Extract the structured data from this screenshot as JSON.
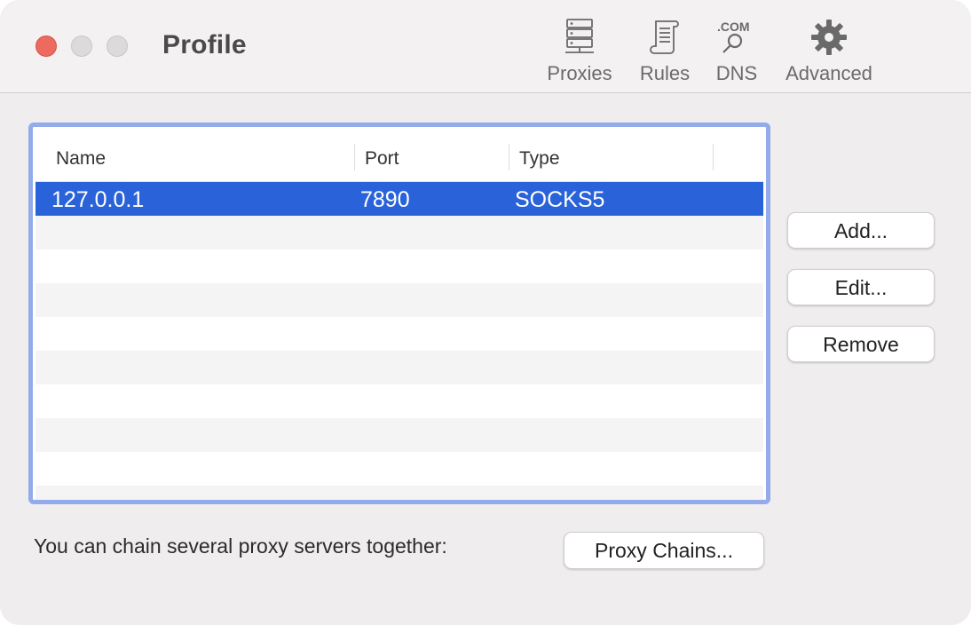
{
  "window": {
    "title": "Profile"
  },
  "toolbar": {
    "items": [
      {
        "label": "Proxies",
        "icon": "server-stack-icon"
      },
      {
        "label": "Rules",
        "icon": "scroll-document-icon"
      },
      {
        "label": "DNS",
        "icon": "dns-magnifier-icon",
        "icon_text": ".COM"
      },
      {
        "label": "Advanced",
        "icon": "gear-icon"
      }
    ]
  },
  "table": {
    "columns": [
      "Name",
      "Port",
      "Type"
    ],
    "rows": [
      {
        "name": "127.0.0.1",
        "port": "7890",
        "type": "SOCKS5",
        "selected": true
      }
    ]
  },
  "buttons": {
    "add": "Add...",
    "edit": "Edit...",
    "remove": "Remove"
  },
  "footer": {
    "chain_text": "You can chain several proxy servers together:",
    "chain_button": "Proxy Chains..."
  },
  "colors": {
    "selection": "#2a63d9",
    "focus_ring": "#93aaeb",
    "close_light": "#ec6a5e"
  }
}
